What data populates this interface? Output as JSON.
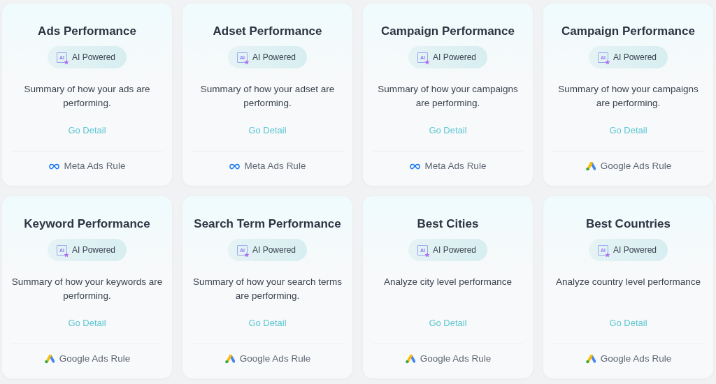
{
  "cards": [
    {
      "title": "Ads Performance",
      "badge": {
        "icon_text": "AI",
        "label": "AI Powered"
      },
      "description": "Summary of how your ads are performing.",
      "link": "Go Detail",
      "footer": {
        "kind": "meta",
        "label": "Meta Ads Rule"
      }
    },
    {
      "title": "Adset Performance",
      "badge": {
        "icon_text": "AI",
        "label": "AI Powered"
      },
      "description": "Summary of how your adset are performing.",
      "link": "Go Detail",
      "footer": {
        "kind": "meta",
        "label": "Meta Ads Rule"
      }
    },
    {
      "title": "Campaign Performance",
      "badge": {
        "icon_text": "AI",
        "label": "AI Powered"
      },
      "description": "Summary of how your campaigns are performing.",
      "link": "Go Detail",
      "footer": {
        "kind": "meta",
        "label": "Meta Ads Rule"
      }
    },
    {
      "title": "Campaign Performance",
      "badge": {
        "icon_text": "AI",
        "label": "AI Powered"
      },
      "description": "Summary of how your campaigns are performing.",
      "link": "Go Detail",
      "footer": {
        "kind": "google",
        "label": "Google Ads Rule"
      }
    },
    {
      "title": "Keyword Performance",
      "badge": {
        "icon_text": "AI",
        "label": "AI Powered"
      },
      "description": "Summary of how your keywords are performing.",
      "link": "Go Detail",
      "footer": {
        "kind": "google",
        "label": "Google Ads Rule"
      }
    },
    {
      "title": "Search Term Performance",
      "badge": {
        "icon_text": "AI",
        "label": "AI Powered"
      },
      "description": "Summary of how your search terms are performing.",
      "link": "Go Detail",
      "footer": {
        "kind": "google",
        "label": "Google Ads Rule"
      }
    },
    {
      "title": "Best Cities",
      "badge": {
        "icon_text": "AI",
        "label": "AI Powered"
      },
      "description": "Analyze city level performance",
      "link": "Go Detail",
      "footer": {
        "kind": "google",
        "label": "Google Ads Rule"
      }
    },
    {
      "title": "Best Countries",
      "badge": {
        "icon_text": "AI",
        "label": "AI Powered"
      },
      "description": "Analyze country level performance",
      "link": "Go Detail",
      "footer": {
        "kind": "google",
        "label": "Google Ads Rule"
      }
    }
  ]
}
